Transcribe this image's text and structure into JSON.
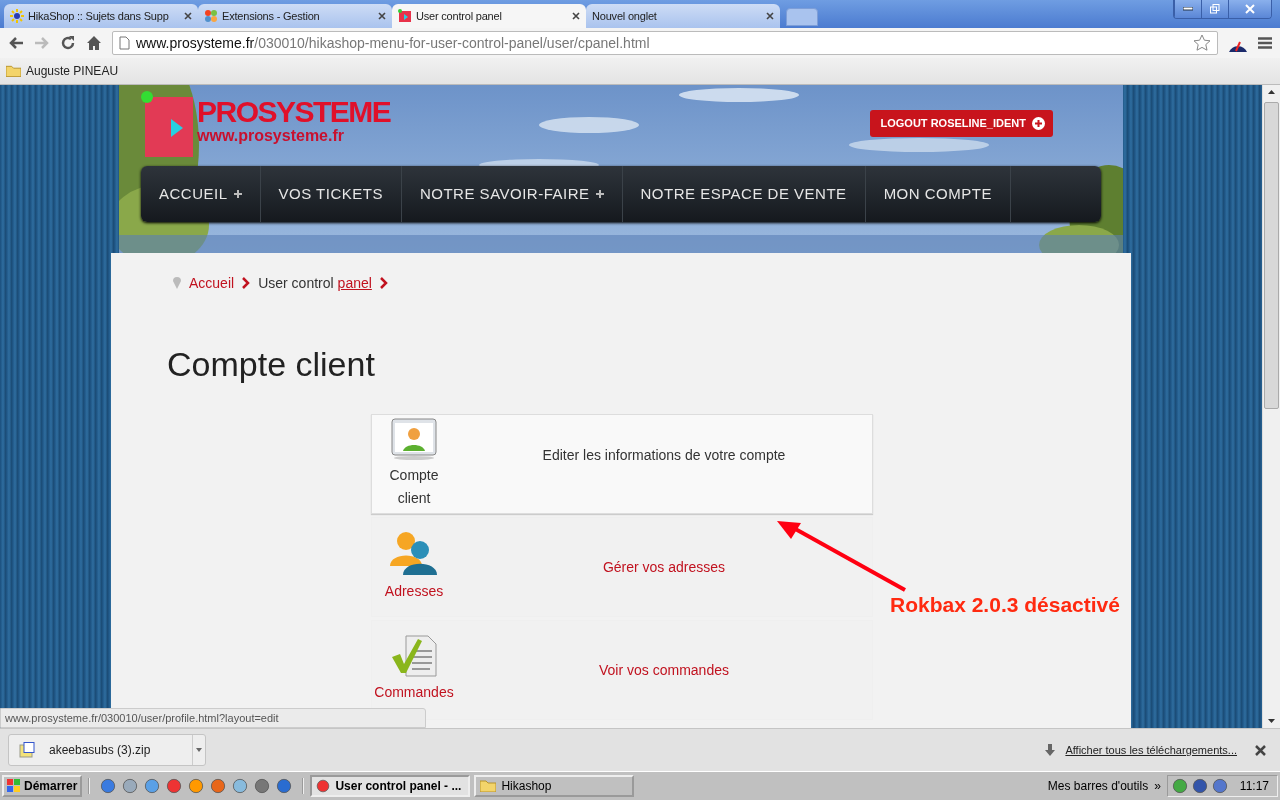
{
  "tabs": [
    {
      "label": "HikaShop :: Sujets dans Supp",
      "kind": "sun",
      "selected": false
    },
    {
      "label": "Extensions - Gestion",
      "kind": "joomla",
      "selected": false
    },
    {
      "label": "User control panel",
      "kind": "site",
      "selected": true
    },
    {
      "label": "Nouvel onglet",
      "kind": "blank",
      "selected": false
    }
  ],
  "address": {
    "domain": "www.prosysteme.fr",
    "path": "/030010/hikashop-menu-for-user-control-panel/user/cpanel.html"
  },
  "bookmarks": [
    {
      "label": "Auguste PINEAU"
    }
  ],
  "site": {
    "logo_name": "PROSYSTEME",
    "logo_url": "www.prosysteme.fr",
    "logout": "LOGOUT ROSELINE_IDENT",
    "nav": [
      {
        "label": "ACCUEIL",
        "has_submenu": true
      },
      {
        "label": "VOS TICKETS",
        "has_submenu": false
      },
      {
        "label": "NOTRE SAVOIR-FAIRE",
        "has_submenu": true
      },
      {
        "label": "NOTRE ESPACE DE VENTE",
        "has_submenu": false
      },
      {
        "label": "MON COMPTE",
        "has_submenu": false
      }
    ],
    "breadcrumb": [
      {
        "label": "Accueil"
      },
      {
        "label": "User control",
        "link": "panel"
      }
    ],
    "title": "Compte client",
    "menu": [
      {
        "label": "Compte client",
        "description": "Editer les informations de votre compte",
        "kind": "profile",
        "highlighted": true
      },
      {
        "label": "Adresses",
        "description": "Gérer vos adresses",
        "kind": "addresses",
        "highlighted": false
      },
      {
        "label": "Commandes",
        "description": "Voir vos commandes",
        "kind": "orders",
        "highlighted": false
      }
    ]
  },
  "annotation": {
    "text": "Rokbax 2.0.3 désactivé"
  },
  "status_url": "www.prosysteme.fr/030010/user/profile.html?layout=edit",
  "downloads": {
    "file": "akeebasubs (3).zip",
    "show_all": "Afficher tous les téléchargements..."
  },
  "taskbar": {
    "start": "Démarrer",
    "windows": [
      {
        "label": "User control panel - ...",
        "kind": "browser",
        "selected": true
      },
      {
        "label": "Hikashop",
        "kind": "folder",
        "selected": false
      }
    ],
    "toolbars": "Mes barres d'outils",
    "chevron": "»",
    "clock": "11:17"
  }
}
